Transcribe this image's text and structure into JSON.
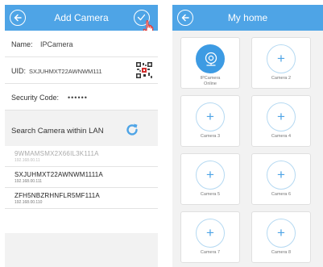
{
  "add_camera": {
    "title": "Add Camera",
    "name_label": "Name:",
    "name_value": "IPCamera",
    "uid_label": "UID:",
    "uid_value": "SXJUHMXT22AWNWM111",
    "security_label": "Security Code:",
    "security_value": "••••••",
    "lan_label": "Search Camera within LAN",
    "lan_items": [
      {
        "name": "9WMAMSMX2X66IL3K111A",
        "ip": "192.168.00.11",
        "added": true
      },
      {
        "name": "SXJUHMXT22AWNWM1111A",
        "ip": "192.168.00.111",
        "added": false
      },
      {
        "name": "ZFH5NBZRHNFLR5MF111A",
        "ip": "192.168.00.110",
        "added": false
      }
    ]
  },
  "my_home": {
    "title": "My home",
    "cameras": [
      {
        "name": "IPCamera",
        "status": "Online",
        "online": true
      },
      {
        "name": "Camera 2",
        "status": "",
        "online": false
      },
      {
        "name": "Camera 3",
        "status": "",
        "online": false
      },
      {
        "name": "Camera 4",
        "status": "",
        "online": false
      },
      {
        "name": "Camera 5",
        "status": "",
        "online": false
      },
      {
        "name": "Camera 6",
        "status": "",
        "online": false
      },
      {
        "name": "Camera 7",
        "status": "",
        "online": false
      },
      {
        "name": "Camera 8",
        "status": "",
        "online": false
      }
    ]
  },
  "colors": {
    "accent": "#4ea4e6",
    "background": "#f2f2f2"
  },
  "icons": {
    "back": "back-arrow-icon",
    "confirm": "check-icon",
    "qr": "qr-code-icon",
    "refresh": "refresh-icon",
    "add": "plus-icon",
    "camera": "webcam-icon"
  }
}
